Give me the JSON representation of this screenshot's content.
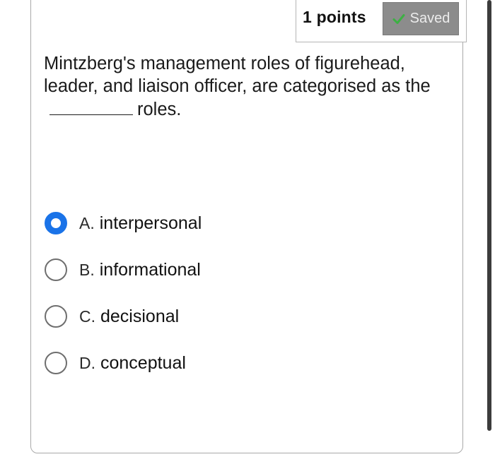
{
  "header": {
    "points_label": "1 points",
    "saved_label": "Saved",
    "saved_icon": "checkmark-icon"
  },
  "question": {
    "text_before": "Mintzberg's management roles of figurehead, leader, and liaison officer, are categorised as the",
    "text_after": "roles."
  },
  "options": [
    {
      "letter": "A.",
      "text": "interpersonal",
      "selected": true
    },
    {
      "letter": "B.",
      "text": "informational",
      "selected": false
    },
    {
      "letter": "C.",
      "text": "decisional",
      "selected": false
    },
    {
      "letter": "D.",
      "text": "conceptual",
      "selected": false
    }
  ],
  "colors": {
    "selected_radio": "#1a73e8",
    "saved_badge_bg": "#8c8c8c",
    "check_green": "#3cb043"
  }
}
